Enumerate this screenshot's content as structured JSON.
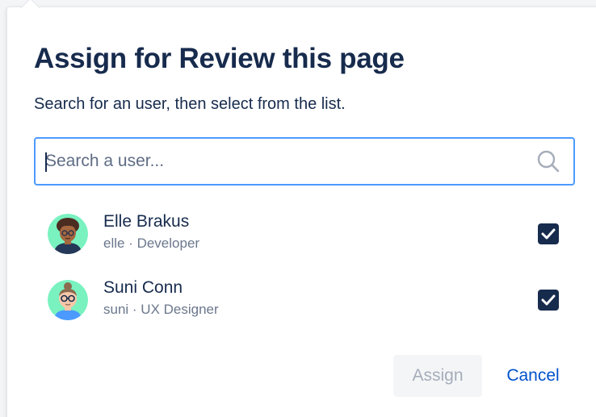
{
  "dialog": {
    "title": "Assign for Review this page",
    "instruction": "Search for an user, then select from the list."
  },
  "search": {
    "placeholder": "Search a user...",
    "value": "",
    "icon": "search-icon"
  },
  "users": [
    {
      "name": "Elle Brakus",
      "meta": "elle · Developer",
      "checked": true,
      "avatar": "elle-avatar"
    },
    {
      "name": "Suni Conn",
      "meta": "suni · UX Designer",
      "checked": true,
      "avatar": "suni-avatar"
    }
  ],
  "actions": {
    "assign_label": "Assign",
    "cancel_label": "Cancel",
    "assign_disabled": true
  },
  "colors": {
    "title": "#172b4d",
    "focus_border": "#4c9aff",
    "checkbox": "#172b4d",
    "link": "#0052cc",
    "avatar_bg": "#79f2c0"
  }
}
